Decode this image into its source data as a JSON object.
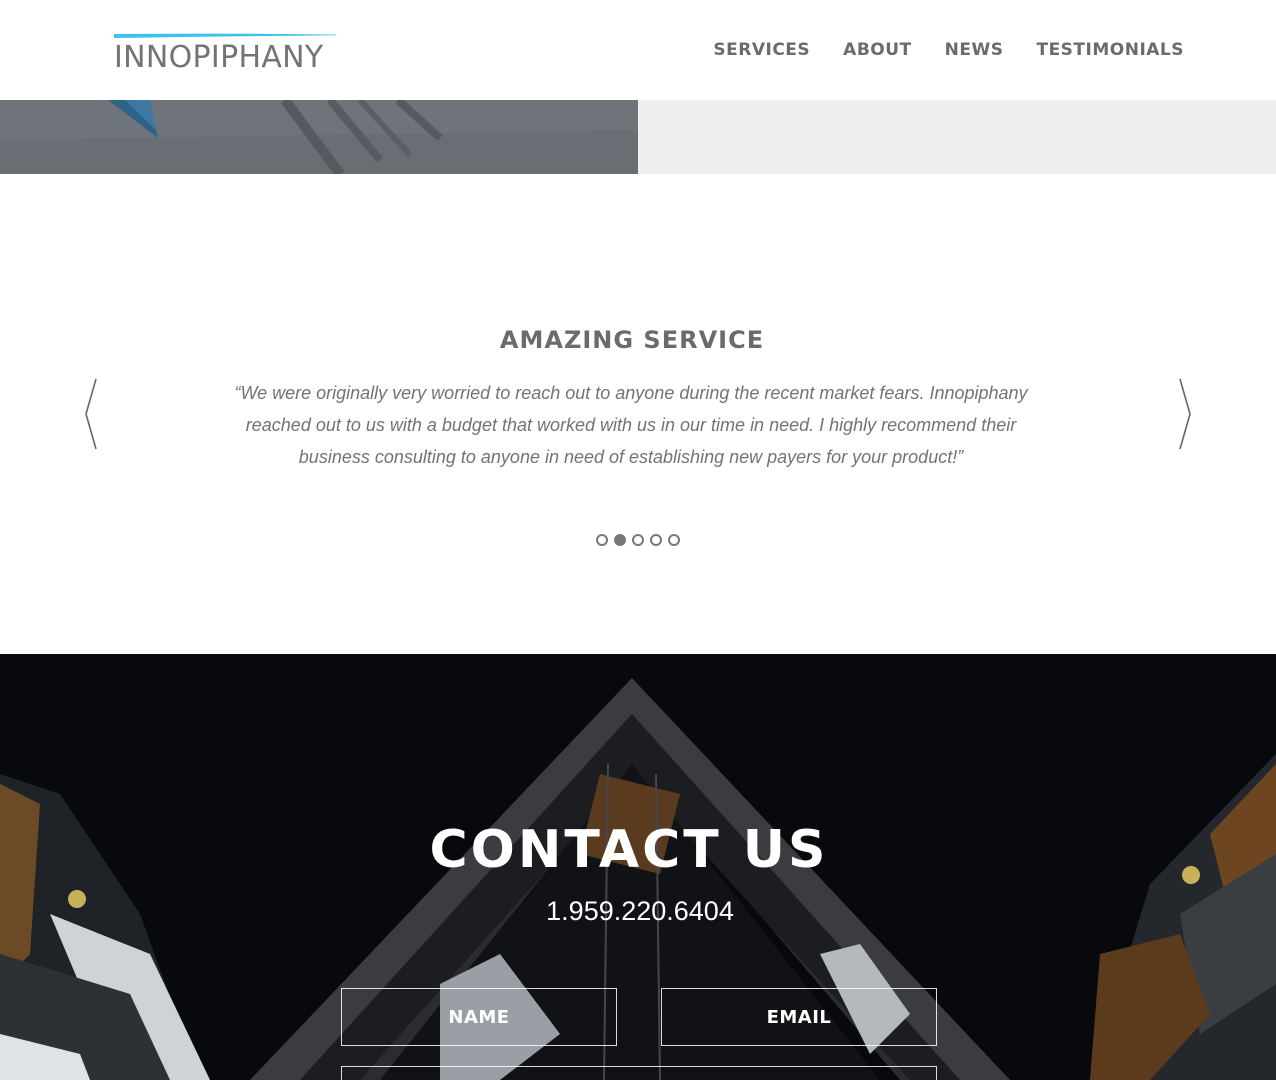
{
  "brand": {
    "logo_text": "INNOPIPHANY",
    "accent_color": "#3fc1f0"
  },
  "nav": {
    "items": [
      {
        "label": "SERVICES"
      },
      {
        "label": "ABOUT"
      },
      {
        "label": "NEWS"
      },
      {
        "label": "TESTIMONIALS"
      }
    ]
  },
  "testimonial": {
    "title": "AMAZING SERVICE",
    "quote": "“We were originally very worried to reach out to anyone during the recent market fears. Innopiphany reached out to us with a budget that worked with us in our time in need. I highly recommend their business consulting to anyone in need of establishing new payers for your product!”",
    "prev_icon": "chevron-left-icon",
    "next_icon": "chevron-right-icon",
    "slides_total": 5,
    "active_slide": 2
  },
  "contact": {
    "title": "CONTACT US",
    "phone": "1.959.220.6404",
    "name_placeholder": "NAME",
    "email_placeholder": "EMAIL"
  }
}
